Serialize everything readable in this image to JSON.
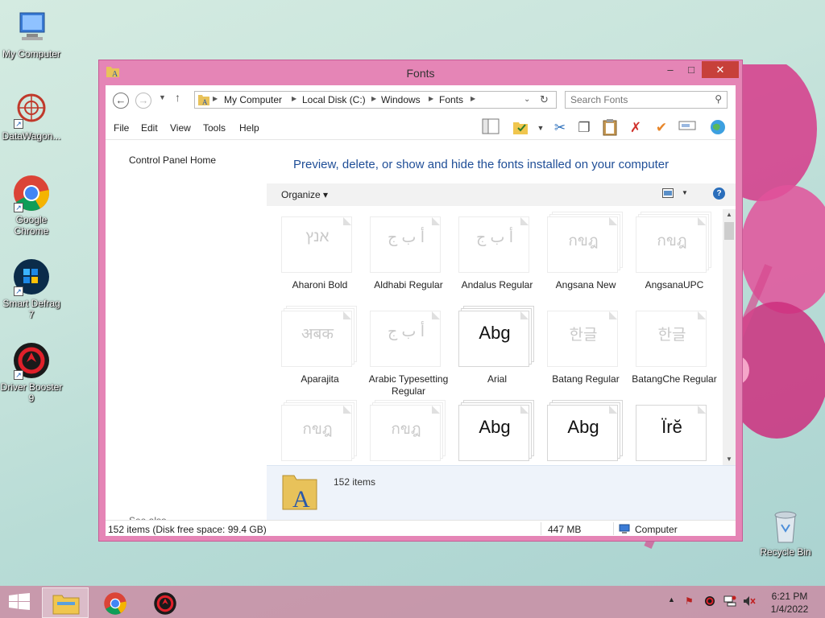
{
  "desktop": {
    "icons": [
      {
        "label": "My Computer"
      },
      {
        "label": "DataWagon..."
      },
      {
        "label": "Google Chrome"
      },
      {
        "label": "Smart Defrag 7"
      },
      {
        "label": "Driver Booster 9"
      }
    ],
    "recycle_bin": "Recycle Bin"
  },
  "window": {
    "title": "Fonts",
    "controls": {
      "minimize": "–",
      "maximize": "□",
      "close": "✕"
    },
    "address": {
      "crumbs": [
        "My Computer",
        "Local Disk (C:)",
        "Windows",
        "Fonts"
      ]
    },
    "search": {
      "placeholder": "Search Fonts"
    },
    "menu": [
      "File",
      "Edit",
      "View",
      "Tools",
      "Help"
    ],
    "left_pane": {
      "home_link": "Control Panel Home",
      "see_also": "See also"
    },
    "headline": "Preview, delete, or show and hide the fonts installed on your computer",
    "organize": "Organize ▾",
    "fonts": [
      {
        "name": "Aharoni Bold",
        "sample": "אנץ",
        "hidden": true,
        "stack": false
      },
      {
        "name": "Aldhabi Regular",
        "sample": "أ ب ج",
        "hidden": true,
        "stack": false
      },
      {
        "name": "Andalus Regular",
        "sample": "أ ب ج",
        "hidden": true,
        "stack": false
      },
      {
        "name": "Angsana New",
        "sample": "กขฎ",
        "hidden": true,
        "stack": true
      },
      {
        "name": "AngsanaUPC",
        "sample": "กขฎ",
        "hidden": true,
        "stack": true
      },
      {
        "name": "Aparajita",
        "sample": "अबक",
        "hidden": true,
        "stack": true
      },
      {
        "name": "Arabic Typesetting Regular",
        "sample": "أ ب ج",
        "hidden": true,
        "stack": false
      },
      {
        "name": "Arial",
        "sample": "Abg",
        "hidden": false,
        "stack": true
      },
      {
        "name": "Batang Regular",
        "sample": "한글",
        "hidden": true,
        "stack": false
      },
      {
        "name": "BatangChe Regular",
        "sample": "한글",
        "hidden": true,
        "stack": false
      },
      {
        "name": "",
        "sample": "กขฎ",
        "hidden": true,
        "stack": true
      },
      {
        "name": "",
        "sample": "กขฎ",
        "hidden": true,
        "stack": true
      },
      {
        "name": "",
        "sample": "Abg",
        "hidden": false,
        "stack": true
      },
      {
        "name": "",
        "sample": "Abg",
        "hidden": false,
        "stack": true
      },
      {
        "name": "",
        "sample": "Ïrĕ",
        "hidden": false,
        "stack": false
      }
    ],
    "details": {
      "count": "152 items"
    },
    "status": {
      "items": "152 items (Disk free space: 99.4 GB)",
      "size": "447 MB",
      "location": "Computer"
    }
  },
  "taskbar": {
    "clock_time": "6:21 PM",
    "clock_date": "1/4/2022",
    "tray_expand": "▲"
  },
  "colors": {
    "window_frame": "#e585b6",
    "close_button": "#c7403a",
    "headline": "#1f4e97"
  }
}
